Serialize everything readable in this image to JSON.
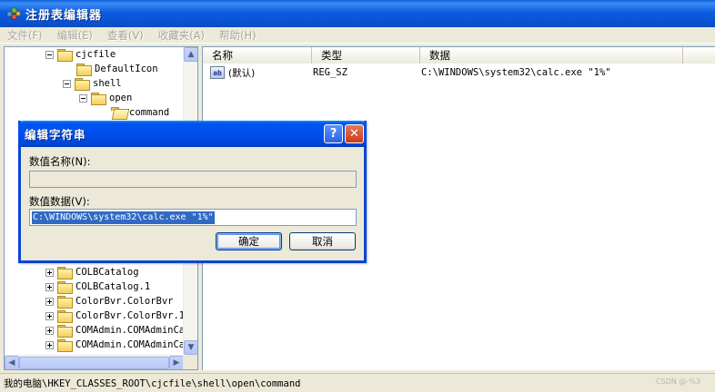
{
  "window": {
    "title": "注册表编辑器"
  },
  "menu": [
    "文件(F)",
    "编辑(E)",
    "查看(V)",
    "收藏夹(A)",
    "帮助(H)"
  ],
  "tree": {
    "top_items": [
      {
        "label": "cjcfile"
      },
      {
        "label": "DefaultIcon"
      },
      {
        "label": "shell"
      },
      {
        "label": "open"
      },
      {
        "label": "command"
      }
    ],
    "bottom_items": [
      {
        "label": "COLBCatalog"
      },
      {
        "label": "COLBCatalog.1"
      },
      {
        "label": "ColorBvr.ColorBvr"
      },
      {
        "label": "ColorBvr.ColorBvr.1"
      },
      {
        "label": "COMAdmin.COMAdminCa"
      },
      {
        "label": "COMAdmin.COMAdminCa"
      }
    ]
  },
  "list": {
    "columns": [
      "名称",
      "类型",
      "数据"
    ],
    "rows": [
      {
        "icon": "ab",
        "name": "(默认)",
        "type": "REG_SZ",
        "data": "C:\\WINDOWS\\system32\\calc.exe \"1%\""
      }
    ]
  },
  "status": {
    "path": "我的电脑\\HKEY_CLASSES_ROOT\\cjcfile\\shell\\open\\command"
  },
  "watermark": "CSDN @-%3",
  "dialog": {
    "title": "编辑字符串",
    "help_glyph": "?",
    "close_glyph": "✕",
    "name_label": "数值名称(N):",
    "name_value": "",
    "data_label": "数值数据(V):",
    "data_value": "C:\\WINDOWS\\system32\\calc.exe \"1%\"",
    "ok_label": "确定",
    "cancel_label": "取消"
  }
}
